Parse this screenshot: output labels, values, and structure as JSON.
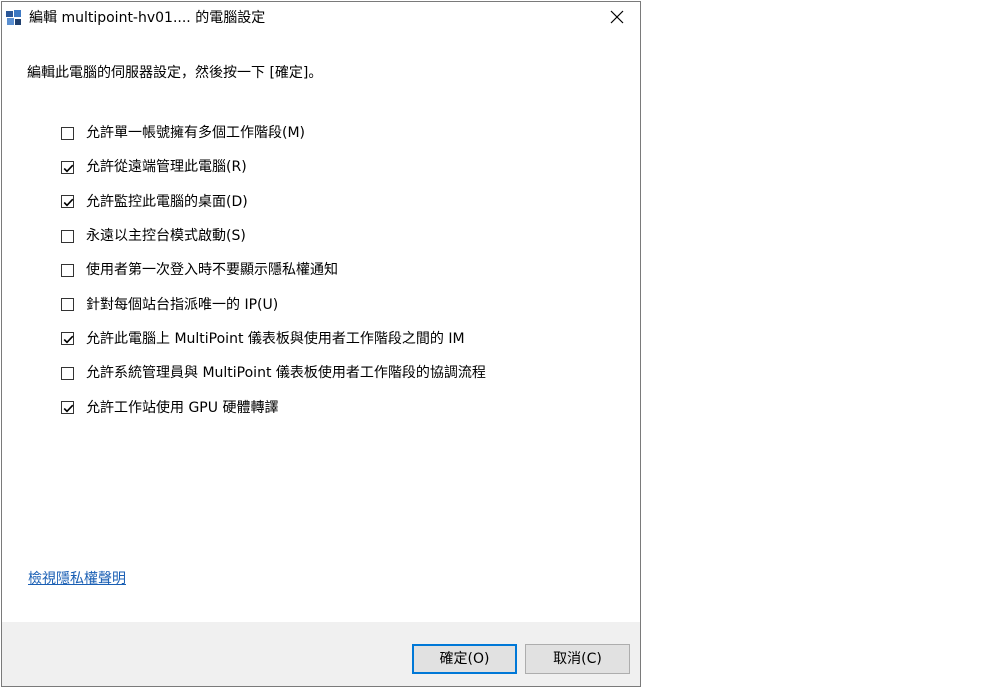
{
  "window": {
    "title": "編輯 multipoint-hv01.... 的電腦設定",
    "close_icon": "close-icon",
    "app_icon": "multipoint-app-icon"
  },
  "instruction": "編輯此電腦的伺服器設定，然後按一下 [確定]。",
  "options": [
    {
      "label": "允許單一帳號擁有多個工作階段(M)",
      "checked": false
    },
    {
      "label": "允許從遠端管理此電腦(R)",
      "checked": true
    },
    {
      "label": "允許監控此電腦的桌面(D)",
      "checked": true
    },
    {
      "label": "永遠以主控台模式啟動(S)",
      "checked": false
    },
    {
      "label": "使用者第一次登入時不要顯示隱私權通知",
      "checked": false
    },
    {
      "label": "針對每個站台指派唯一的 IP(U)",
      "checked": false
    },
    {
      "label": "允許此電腦上 MultiPoint 儀表板與使用者工作階段之間的 IM",
      "checked": true
    },
    {
      "label": "允許系統管理員與 MultiPoint 儀表板使用者工作階段的協調流程",
      "checked": false
    },
    {
      "label": "允許工作站使用 GPU 硬體轉譯",
      "checked": true
    }
  ],
  "privacy_link": "檢視隱私權聲明",
  "buttons": {
    "ok": "確定(O)",
    "cancel": "取消(C)"
  },
  "colors": {
    "link": "#1a5fb4",
    "footer_bg": "#f0f0f0",
    "default_button_border": "#0078d7"
  }
}
